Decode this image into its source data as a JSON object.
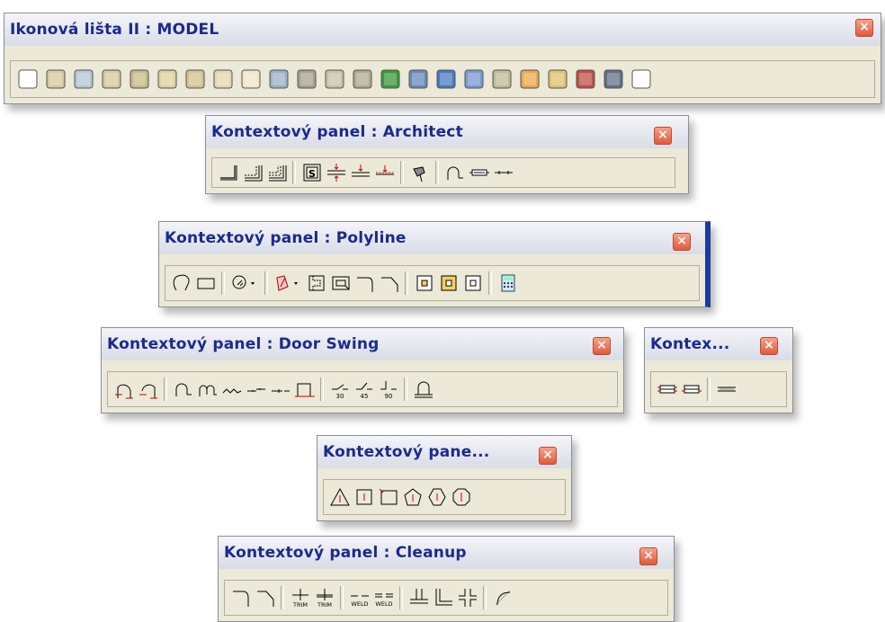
{
  "model_panel": {
    "title": "Ikonová lišta II : MODEL",
    "close": "×"
  },
  "architect_panel": {
    "title": "Kontextový panel : Architect",
    "close": "×"
  },
  "polyline_panel": {
    "title": "Kontextový panel : Polyline",
    "close": "×"
  },
  "doorswing_panel": {
    "title": "Kontextový panel : Door Swing",
    "close": "×",
    "angle_labels": [
      "30",
      "45",
      "90"
    ]
  },
  "small_panel": {
    "title": "Kontex...",
    "close": "×"
  },
  "pane_panel": {
    "title": "Kontextový pane...",
    "close": "×"
  },
  "cleanup_panel": {
    "title": "Kontextový panel : Cleanup",
    "close": "×",
    "trim_label": "TRIM",
    "weld_label": "WELD"
  },
  "icons": {
    "model": [
      "box-icon",
      "wedge-icon",
      "slab-icon",
      "cylinder-icon",
      "tube-icon",
      "cone-icon",
      "rounded-box-icon",
      "sphere-icon",
      "torus-icon",
      "prism-icon",
      "i-beam-icon",
      "column-icon",
      "pyramid-icon",
      "terrain-icon",
      "texture-icon",
      "boolean-icon",
      "fillet-icon",
      "loft-icon",
      "extrude-icon",
      "section-icon",
      "revolve-icon",
      "boolean-subtract-icon",
      "render-icon"
    ]
  },
  "colors": {
    "title_text": "#1a2a90",
    "close_button": "#e05a3c",
    "panel_bg": "#ece9d8"
  }
}
